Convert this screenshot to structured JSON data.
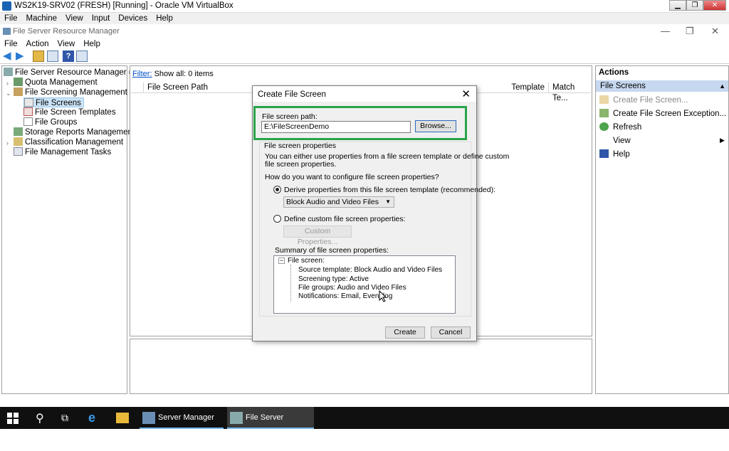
{
  "vbox": {
    "title": "WS2K19-SRV02 (FRESH) [Running] - Oracle VM VirtualBox",
    "menu": [
      "File",
      "Machine",
      "View",
      "Input",
      "Devices",
      "Help"
    ]
  },
  "fsrm": {
    "title": "File Server Resource Manager",
    "menu": [
      "File",
      "Action",
      "View",
      "Help"
    ]
  },
  "tree": {
    "root": "File Server Resource Manager (Local)",
    "quota": "Quota Management",
    "screening": "File Screening Management",
    "screens": "File Screens",
    "templates": "File Screen Templates",
    "groups": "File Groups",
    "storage": "Storage Reports Management",
    "classification": "Classification Management",
    "tasks": "File Management Tasks"
  },
  "center": {
    "filter_link": "Filter:",
    "filter_text": "Show all: 0 items",
    "col_path": "File Screen Path",
    "col_template": "Template",
    "col_match": "Match Te..."
  },
  "actions": {
    "title": "Actions",
    "section": "File Screens",
    "items": [
      "Create File Screen...",
      "Create File Screen Exception...",
      "Refresh",
      "View",
      "Help"
    ]
  },
  "dialog": {
    "title": "Create File Screen",
    "path_label": "File screen path:",
    "path_value": "E:\\FileScreenDemo",
    "browse": "Browse...",
    "props_label": "File screen properties",
    "props_desc1": "You can either use properties from a file screen template or define custom",
    "props_desc2": "file screen properties.",
    "question": "How do you want to configure file screen properties?",
    "opt_derive": "Derive properties from this file screen template (recommended):",
    "template_selected": "Block Audio and Video Files",
    "opt_custom": "Define custom file screen properties:",
    "custom_btn": "Custom Properties...",
    "summary_label": "Summary of file screen properties:",
    "summary_root": "File screen:",
    "summary_items": [
      "Source template: Block Audio and Video Files",
      "Screening type: Active",
      "File groups: Audio and Video Files",
      "Notifications: Email, Event log"
    ],
    "create": "Create",
    "cancel": "Cancel"
  },
  "taskbar": {
    "apps": [
      "Server Manager",
      "File Server Resourc..."
    ]
  }
}
